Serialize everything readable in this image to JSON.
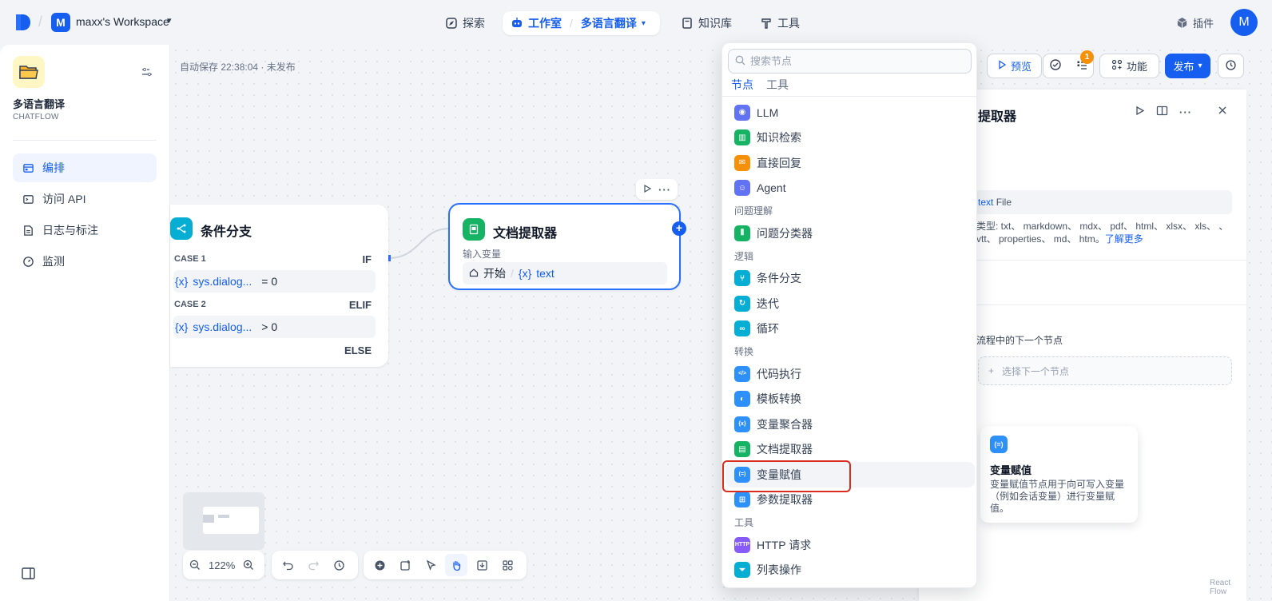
{
  "topbar": {
    "workspace_initial": "M",
    "workspace_name": "maxx's Workspace",
    "nav": {
      "explore": "探索",
      "studio": "工作室",
      "current_app": "多语言翻译",
      "knowledge": "知识库",
      "tools": "工具"
    },
    "plugins": "插件",
    "avatar_initial": "M"
  },
  "sidebar": {
    "app_name": "多语言翻译",
    "app_type": "CHATFLOW",
    "items": [
      {
        "label": "编排",
        "icon": "layout-icon"
      },
      {
        "label": "访问 API",
        "icon": "terminal-icon"
      },
      {
        "label": "日志与标注",
        "icon": "file-icon"
      },
      {
        "label": "监测",
        "icon": "dashboard-icon"
      }
    ]
  },
  "canvas": {
    "autosave": "自动保存 22:38:04 · 未发布",
    "if_node": {
      "title": "条件分支",
      "case1": "CASE 1",
      "case1_tag": "IF",
      "case1_var": "sys.dialog...",
      "case1_cond": "= 0",
      "case2": "CASE 2",
      "case2_tag": "ELIF",
      "case2_var": "sys.dialog...",
      "case2_cond": "> 0",
      "else_tag": "ELSE",
      "var_symbol": "{x}"
    },
    "doc_node": {
      "title": "文档提取器",
      "input_label": "输入变量",
      "source": "开始",
      "sep": "/",
      "var": "text",
      "var_symbol": "{x}"
    },
    "zoom": "122%"
  },
  "toolbar_right": {
    "preview": "预览",
    "badge_count": "1",
    "features": "功能",
    "publish": "发布"
  },
  "panel": {
    "title": "提取器",
    "field_var": "text",
    "field_type": "File",
    "types_text": "类型: txt、 markdown、 mdx、 pdf、 html、 xlsx、 xls、 、 vtt、 properties、 md、 htm。",
    "learn_more": "了解更多",
    "next_label": "流程中的下一个节点",
    "next_placeholder": "选择下一个节点",
    "watermark": "React Flow"
  },
  "tooltip": {
    "title": "变量赋值",
    "desc": "变量赋值节点用于向可写入变量（例如会话变量）进行变量赋值。"
  },
  "dropdown": {
    "search_placeholder": "搜索节点",
    "tabs": [
      "节点",
      "工具"
    ],
    "groups": [
      {
        "category": "",
        "items": [
          {
            "label": "LLM",
            "color": "#6172f3",
            "glyph": "◉"
          },
          {
            "label": "知识检索",
            "color": "#16b364",
            "glyph": "▥"
          },
          {
            "label": "直接回复",
            "color": "#f79009",
            "glyph": "✉"
          },
          {
            "label": "Agent",
            "color": "#6172f3",
            "glyph": "☺"
          }
        ]
      },
      {
        "category": "问题理解",
        "items": [
          {
            "label": "问题分类器",
            "color": "#16b364",
            "glyph": "⫴"
          }
        ]
      },
      {
        "category": "逻辑",
        "items": [
          {
            "label": "条件分支",
            "color": "#06aed4",
            "glyph": "⑂"
          },
          {
            "label": "迭代",
            "color": "#06aed4",
            "glyph": "↻"
          },
          {
            "label": "循环",
            "color": "#06aed4",
            "glyph": "∞"
          }
        ]
      },
      {
        "category": "转换",
        "items": [
          {
            "label": "代码执行",
            "color": "#2e90fa",
            "glyph": "</>"
          },
          {
            "label": "模板转换",
            "color": "#2e90fa",
            "glyph": "◐"
          },
          {
            "label": "变量聚合器",
            "color": "#2e90fa",
            "glyph": "{x}"
          },
          {
            "label": "文档提取器",
            "color": "#16b364",
            "glyph": "▤"
          },
          {
            "label": "变量赋值",
            "color": "#2e90fa",
            "glyph": "(=)"
          },
          {
            "label": "参数提取器",
            "color": "#2e90fa",
            "glyph": "⊞"
          }
        ]
      },
      {
        "category": "工具",
        "items": [
          {
            "label": "HTTP 请求",
            "color": "#875bf7",
            "glyph": "HTTP"
          },
          {
            "label": "列表操作",
            "color": "#06aed4",
            "glyph": "⏷"
          }
        ]
      }
    ],
    "highlighted": "变量赋值"
  }
}
